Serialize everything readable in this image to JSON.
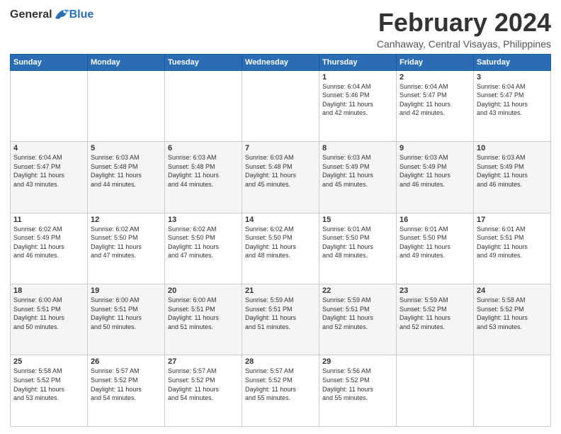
{
  "logo": {
    "general": "General",
    "blue": "Blue"
  },
  "title": "February 2024",
  "location": "Canhaway, Central Visayas, Philippines",
  "days_header": [
    "Sunday",
    "Monday",
    "Tuesday",
    "Wednesday",
    "Thursday",
    "Friday",
    "Saturday"
  ],
  "weeks": [
    [
      {
        "day": "",
        "info": ""
      },
      {
        "day": "",
        "info": ""
      },
      {
        "day": "",
        "info": ""
      },
      {
        "day": "",
        "info": ""
      },
      {
        "day": "1",
        "info": "Sunrise: 6:04 AM\nSunset: 5:46 PM\nDaylight: 11 hours\nand 42 minutes."
      },
      {
        "day": "2",
        "info": "Sunrise: 6:04 AM\nSunset: 5:47 PM\nDaylight: 11 hours\nand 42 minutes."
      },
      {
        "day": "3",
        "info": "Sunrise: 6:04 AM\nSunset: 5:47 PM\nDaylight: 11 hours\nand 43 minutes."
      }
    ],
    [
      {
        "day": "4",
        "info": "Sunrise: 6:04 AM\nSunset: 5:47 PM\nDaylight: 11 hours\nand 43 minutes."
      },
      {
        "day": "5",
        "info": "Sunrise: 6:03 AM\nSunset: 5:48 PM\nDaylight: 11 hours\nand 44 minutes."
      },
      {
        "day": "6",
        "info": "Sunrise: 6:03 AM\nSunset: 5:48 PM\nDaylight: 11 hours\nand 44 minutes."
      },
      {
        "day": "7",
        "info": "Sunrise: 6:03 AM\nSunset: 5:48 PM\nDaylight: 11 hours\nand 45 minutes."
      },
      {
        "day": "8",
        "info": "Sunrise: 6:03 AM\nSunset: 5:49 PM\nDaylight: 11 hours\nand 45 minutes."
      },
      {
        "day": "9",
        "info": "Sunrise: 6:03 AM\nSunset: 5:49 PM\nDaylight: 11 hours\nand 46 minutes."
      },
      {
        "day": "10",
        "info": "Sunrise: 6:03 AM\nSunset: 5:49 PM\nDaylight: 11 hours\nand 46 minutes."
      }
    ],
    [
      {
        "day": "11",
        "info": "Sunrise: 6:02 AM\nSunset: 5:49 PM\nDaylight: 11 hours\nand 46 minutes."
      },
      {
        "day": "12",
        "info": "Sunrise: 6:02 AM\nSunset: 5:50 PM\nDaylight: 11 hours\nand 47 minutes."
      },
      {
        "day": "13",
        "info": "Sunrise: 6:02 AM\nSunset: 5:50 PM\nDaylight: 11 hours\nand 47 minutes."
      },
      {
        "day": "14",
        "info": "Sunrise: 6:02 AM\nSunset: 5:50 PM\nDaylight: 11 hours\nand 48 minutes."
      },
      {
        "day": "15",
        "info": "Sunrise: 6:01 AM\nSunset: 5:50 PM\nDaylight: 11 hours\nand 48 minutes."
      },
      {
        "day": "16",
        "info": "Sunrise: 6:01 AM\nSunset: 5:50 PM\nDaylight: 11 hours\nand 49 minutes."
      },
      {
        "day": "17",
        "info": "Sunrise: 6:01 AM\nSunset: 5:51 PM\nDaylight: 11 hours\nand 49 minutes."
      }
    ],
    [
      {
        "day": "18",
        "info": "Sunrise: 6:00 AM\nSunset: 5:51 PM\nDaylight: 11 hours\nand 50 minutes."
      },
      {
        "day": "19",
        "info": "Sunrise: 6:00 AM\nSunset: 5:51 PM\nDaylight: 11 hours\nand 50 minutes."
      },
      {
        "day": "20",
        "info": "Sunrise: 6:00 AM\nSunset: 5:51 PM\nDaylight: 11 hours\nand 51 minutes."
      },
      {
        "day": "21",
        "info": "Sunrise: 5:59 AM\nSunset: 5:51 PM\nDaylight: 11 hours\nand 51 minutes."
      },
      {
        "day": "22",
        "info": "Sunrise: 5:59 AM\nSunset: 5:51 PM\nDaylight: 11 hours\nand 52 minutes."
      },
      {
        "day": "23",
        "info": "Sunrise: 5:59 AM\nSunset: 5:52 PM\nDaylight: 11 hours\nand 52 minutes."
      },
      {
        "day": "24",
        "info": "Sunrise: 5:58 AM\nSunset: 5:52 PM\nDaylight: 11 hours\nand 53 minutes."
      }
    ],
    [
      {
        "day": "25",
        "info": "Sunrise: 5:58 AM\nSunset: 5:52 PM\nDaylight: 11 hours\nand 53 minutes."
      },
      {
        "day": "26",
        "info": "Sunrise: 5:57 AM\nSunset: 5:52 PM\nDaylight: 11 hours\nand 54 minutes."
      },
      {
        "day": "27",
        "info": "Sunrise: 5:57 AM\nSunset: 5:52 PM\nDaylight: 11 hours\nand 54 minutes."
      },
      {
        "day": "28",
        "info": "Sunrise: 5:57 AM\nSunset: 5:52 PM\nDaylight: 11 hours\nand 55 minutes."
      },
      {
        "day": "29",
        "info": "Sunrise: 5:56 AM\nSunset: 5:52 PM\nDaylight: 11 hours\nand 55 minutes."
      },
      {
        "day": "",
        "info": ""
      },
      {
        "day": "",
        "info": ""
      }
    ]
  ]
}
